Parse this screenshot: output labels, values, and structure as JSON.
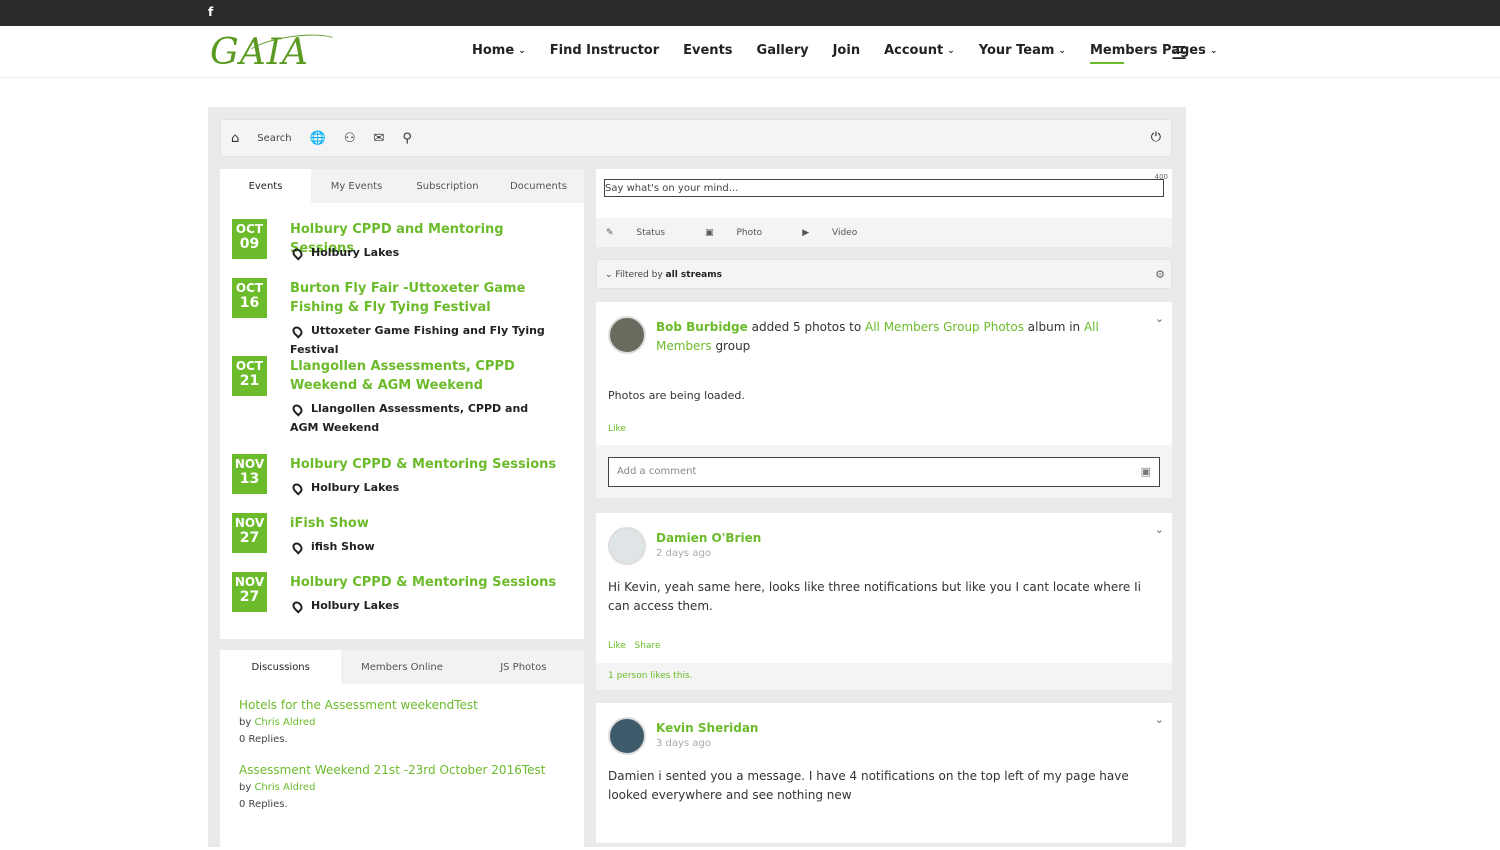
{
  "topbar": {
    "facebook": "f"
  },
  "brand": {
    "logo": "GAIA"
  },
  "nav": [
    {
      "label": "Home",
      "dropdown": true
    },
    {
      "label": "Find Instructor",
      "dropdown": false
    },
    {
      "label": "Events",
      "dropdown": false
    },
    {
      "label": "Gallery",
      "dropdown": false
    },
    {
      "label": "Join",
      "dropdown": false
    },
    {
      "label": "Account",
      "dropdown": true
    },
    {
      "label": "Your Team",
      "dropdown": true
    },
    {
      "label": "Members Pages",
      "dropdown": true
    }
  ],
  "toolbar": {
    "search_label": "Search"
  },
  "events_tabs": [
    "Events",
    "My Events",
    "Subscription",
    "Documents"
  ],
  "events": [
    {
      "month": "OCT",
      "day": "09",
      "title": "Holbury CPPD and Mentoring Sessions",
      "location": "Holbury Lakes"
    },
    {
      "month": "OCT",
      "day": "16",
      "title": "Burton Fly Fair -Uttoxeter Game Fishing & Fly Tying Festival",
      "location": "Uttoxeter Game Fishing and Fly Tying Festival"
    },
    {
      "month": "OCT",
      "day": "21",
      "title": "Llangollen Assessments, CPPD Weekend & AGM Weekend",
      "location": "Llangollen Assessments, CPPD and AGM Weekend"
    },
    {
      "month": "NOV",
      "day": "13",
      "title": "Holbury CPPD & Mentoring Sessions",
      "location": "Holbury Lakes"
    },
    {
      "month": "NOV",
      "day": "27",
      "title": "iFish Show",
      "location": "ifish Show"
    },
    {
      "month": "NOV",
      "day": "27",
      "title": "Holbury CPPD & Mentoring Sessions",
      "location": "Holbury Lakes"
    }
  ],
  "disc_tabs": [
    "Discussions",
    "Members Online",
    "JS Photos"
  ],
  "discussions": [
    {
      "title": "Hotels for the Assessment weekendTest",
      "by": "by",
      "author": "Chris Aldred",
      "replies": "0 Replies."
    },
    {
      "title": "Assessment Weekend 21st -23rd October 2016Test",
      "by": "by",
      "author": "Chris Aldred",
      "replies": "0 Replies."
    }
  ],
  "composer": {
    "placeholder": "Say what's on your mind...",
    "count": "400",
    "status": "Status",
    "photo": "Photo",
    "video": "Video"
  },
  "filter": {
    "prefix": "Filtered by",
    "value": "all streams"
  },
  "post1": {
    "author": "Bob Burbidge",
    "text_a": " added 5 photos to ",
    "album": "All Members Group Photos",
    "text_b": " album in ",
    "group": "All Members",
    "text_c": " group",
    "body": "Photos are being loaded.",
    "like": "Like",
    "comment_placeholder": "Add a comment"
  },
  "post2": {
    "author": "Damien O'Brien",
    "time": "2 days ago",
    "body": "Hi Kevin, yeah same here, looks like three notifications but like you I cant locate where Ii can access them.",
    "like": "Like",
    "share": "Share",
    "likes_count": "1 person likes this."
  },
  "post3": {
    "author": "Kevin Sheridan",
    "time": "3 days ago",
    "body": "Damien i sented you a message. I have 4 notifications on the top left of my page have looked everywhere and see nothing new"
  }
}
